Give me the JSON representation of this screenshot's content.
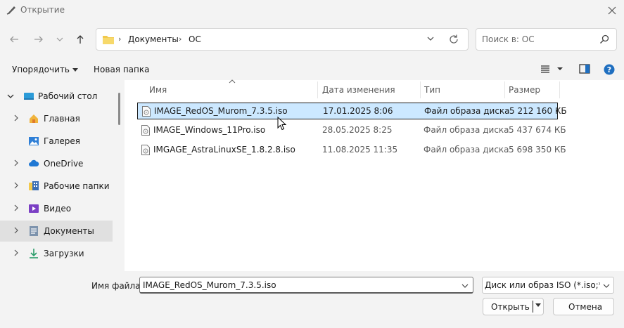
{
  "window": {
    "title": "Открытие"
  },
  "nav": {
    "breadcrumbs": [
      "Документы",
      "ОС"
    ],
    "search_placeholder": "Поиск в: ОС"
  },
  "commands": {
    "organize": "Упорядочить",
    "new_folder": "Новая папка"
  },
  "sidebar": {
    "items": [
      {
        "label": "Рабочий стол",
        "icon": "desktop-icon",
        "expanded": true
      },
      {
        "label": "Главная",
        "icon": "home-icon"
      },
      {
        "label": "Галерея",
        "icon": "gallery-icon"
      },
      {
        "label": "OneDrive",
        "icon": "cloud-icon"
      },
      {
        "label": "Рабочие папки",
        "icon": "work-folders-icon"
      },
      {
        "label": "Видео",
        "icon": "video-icon"
      },
      {
        "label": "Документы",
        "icon": "documents-icon",
        "selected": true
      },
      {
        "label": "Загрузки",
        "icon": "download-icon"
      }
    ]
  },
  "files": {
    "columns": {
      "name": "Имя",
      "date": "Дата изменения",
      "type": "Тип",
      "size": "Размер"
    },
    "rows": [
      {
        "name": "IMAGE_RedOS_Murom_7.3.5.iso",
        "date": "17.01.2025 8:06",
        "type": "Файл образа диска",
        "size": "5 212 160 КБ",
        "selected": true
      },
      {
        "name": "IMAGE_Windows_11Pro.iso",
        "date": "28.05.2025 8:25",
        "type": "Файл образа диска",
        "size": "5 437 674 КБ"
      },
      {
        "name": "IMGAGE_AstraLinuxSE_1.8.2.8.iso",
        "date": "11.08.2025 11:35",
        "type": "Файл образа диска",
        "size": "5 698 350 КБ"
      }
    ]
  },
  "bottom": {
    "filename_label": "Имя файла:",
    "filename_value": "IMAGE_RedOS_Murom_7.3.5.iso",
    "filter": "Диск или образ ISO (*.iso;*.img",
    "open": "Открыть",
    "cancel": "Отмена"
  },
  "colors": {
    "accent": "#0067c0",
    "selection": "#cce8ff",
    "folder": "#f2c94c"
  }
}
